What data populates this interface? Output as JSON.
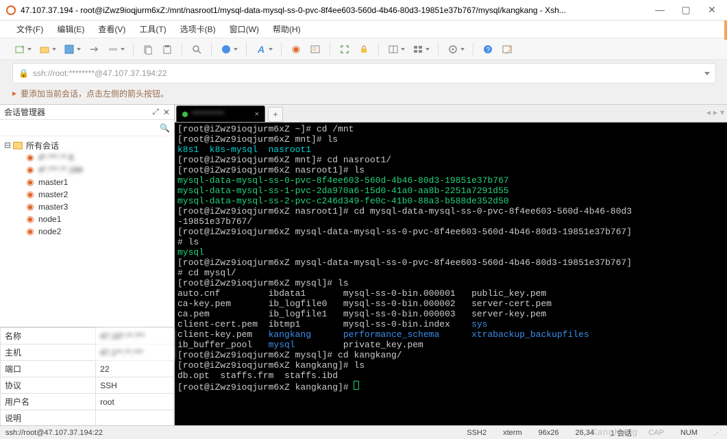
{
  "window": {
    "ip": "47.107.37.194",
    "title": "47.107.37.194 - root@iZwz9ioqjurm6xZ:/mnt/nasroot1/mysql-data-mysql-ss-0-pvc-8f4ee603-560d-4b46-80d3-19851e37b767/mysql/kangkang - Xsh..."
  },
  "menu": {
    "file": "文件(F)",
    "edit": "编辑(E)",
    "view": "查看(V)",
    "tools": "工具(T)",
    "tabs": "选项卡(B)",
    "window": "窗口(W)",
    "help": "帮助(H)"
  },
  "urlbar": {
    "text": "ssh://root:********@47.107.37.194:22"
  },
  "tip": {
    "text": "要添加当前会话，点击左侧的箭头按钮。"
  },
  "sidebar": {
    "title": "会话管理器",
    "root": "所有会话",
    "items": [
      {
        "label": "4*.***.**.6"
      },
      {
        "label": "4*.***.**.194"
      },
      {
        "label": "master1"
      },
      {
        "label": "master2"
      },
      {
        "label": "master3"
      },
      {
        "label": "node1"
      },
      {
        "label": "node2"
      }
    ]
  },
  "props": {
    "name_k": "名称",
    "name_v": "47.10*.**.***",
    "host_k": "主机",
    "host_v": "47.1**.**.***",
    "port_k": "端口",
    "port_v": "22",
    "proto_k": "协议",
    "proto_v": "SSH",
    "user_k": "用户名",
    "user_v": "root",
    "desc_k": "说明",
    "desc_v": ""
  },
  "terminal": {
    "tab_label": "***********",
    "l1_prompt": "[root@iZwz9ioqjurm6xZ ~]# ",
    "l1_cmd": "cd /mnt",
    "l2_prompt": "[root@iZwz9ioqjurm6xZ mnt]# ",
    "l2_cmd": "ls",
    "l3": "k8s1  k8s-mysql  nasroot1",
    "l4_prompt": "[root@iZwz9ioqjurm6xZ mnt]# ",
    "l4_cmd": "cd nasroot1/",
    "l5_prompt": "[root@iZwz9ioqjurm6xZ nasroot1]# ",
    "l5_cmd": "ls",
    "l6": "mysql-data-mysql-ss-0-pvc-8f4ee603-560d-4b46-80d3-19851e37b767",
    "l7": "mysql-data-mysql-ss-1-pvc-2da970a6-15d0-41a0-aa8b-2251a7291d55",
    "l8": "mysql-data-mysql-ss-2-pvc-c246d349-fe0c-41b0-88a3-b588de352d50",
    "l9_prompt": "[root@iZwz9ioqjurm6xZ nasroot1]# ",
    "l9_cmd": "cd mysql-data-mysql-ss-0-pvc-8f4ee603-560d-4b46-80d3",
    "l10": "-19851e37b767/",
    "l11_prompt": "[root@iZwz9ioqjurm6xZ mysql-data-mysql-ss-0-pvc-8f4ee603-560d-4b46-80d3-19851e37b767]",
    "l12": "# ls",
    "l13": "mysql",
    "l14_prompt": "[root@iZwz9ioqjurm6xZ mysql-data-mysql-ss-0-pvc-8f4ee603-560d-4b46-80d3-19851e37b767]",
    "l15": "# cd mysql/",
    "l16_prompt": "[root@iZwz9ioqjurm6xZ mysql]# ",
    "l16_cmd": "ls",
    "ls_rows": [
      [
        "auto.cnf",
        "ibdata1",
        "mysql-ss-0-bin.000001",
        "public_key.pem"
      ],
      [
        "ca-key.pem",
        "ib_logfile0",
        "mysql-ss-0-bin.000002",
        "server-cert.pem"
      ],
      [
        "ca.pem",
        "ib_logfile1",
        "mysql-ss-0-bin.000003",
        "server-key.pem"
      ],
      [
        "client-cert.pem",
        "ibtmp1",
        "mysql-ss-0-bin.index",
        "sys"
      ],
      [
        "client-key.pem",
        "kangkang",
        "performance_schema",
        "xtrabackup_backupfiles"
      ],
      [
        "ib_buffer_pool",
        "mysql",
        "private_key.pem",
        ""
      ]
    ],
    "ls_blue": [
      "sys",
      "kangkang",
      "performance_schema",
      "xtrabackup_backupfiles",
      "mysql"
    ],
    "l23_prompt": "[root@iZwz9ioqjurm6xZ mysql]# ",
    "l23_cmd": "cd kangkang/",
    "l24_prompt": "[root@iZwz9ioqjurm6xZ kangkang]# ",
    "l24_cmd": "ls",
    "l25": "db.opt  staffs.frm  staffs.ibd",
    "l26_prompt": "[root@iZwz9ioqjurm6xZ kangkang]# "
  },
  "status": {
    "left": "ssh://root@47.107.37.194:22",
    "mode": "SSH2",
    "term": "xterm",
    "size": "96x26",
    "pos": "26,34",
    "sess": "1 会话",
    "caps": "CAP",
    "num": "NUM",
    "watermark": "xKangKang"
  }
}
